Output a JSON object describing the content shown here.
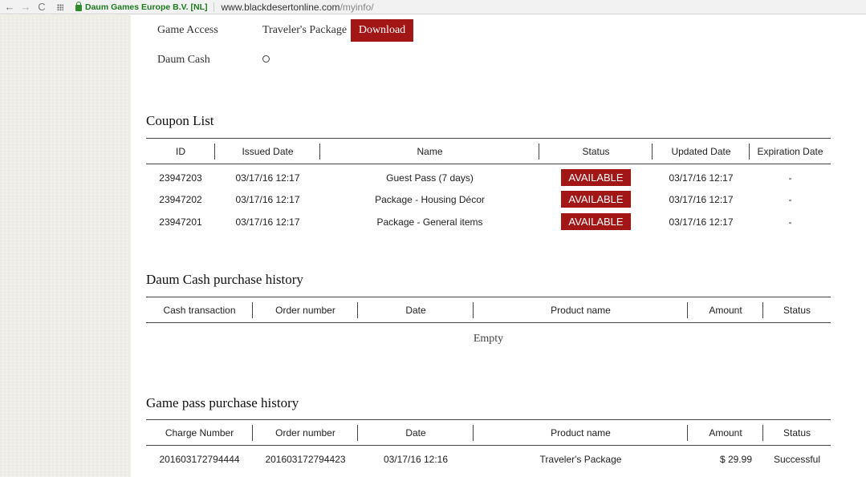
{
  "browser": {
    "back_glyph": "←",
    "forward_glyph": "→",
    "reload_glyph": "C",
    "cert_name": "Daum Games Europe B.V. [NL]",
    "url_host": "www.blackdesertonline.com",
    "url_path": "/myinfo/"
  },
  "account": {
    "game_access_label": "Game Access",
    "game_access_value": "Traveler's Package",
    "download_label": "Download",
    "daum_cash_label": "Daum Cash"
  },
  "coupons": {
    "title": "Coupon List",
    "headers": [
      "ID",
      "Issued Date",
      "Name",
      "Status",
      "Updated Date",
      "Expiration Date"
    ],
    "rows": [
      {
        "id": "23947203",
        "issued": "03/17/16 12:17",
        "name": "Guest Pass (7 days)",
        "status": "AVAILABLE",
        "updated": "03/17/16 12:17",
        "expiration": "-"
      },
      {
        "id": "23947202",
        "issued": "03/17/16 12:17",
        "name": "Package - Housing Décor",
        "status": "AVAILABLE",
        "updated": "03/17/16 12:17",
        "expiration": "-"
      },
      {
        "id": "23947201",
        "issued": "03/17/16 12:17",
        "name": "Package - General items",
        "status": "AVAILABLE",
        "updated": "03/17/16 12:17",
        "expiration": "-"
      }
    ]
  },
  "cash_history": {
    "title": "Daum Cash purchase history",
    "headers": [
      "Cash transaction",
      "Order number",
      "Date",
      "Product name",
      "Amount",
      "Status"
    ],
    "empty_text": "Empty"
  },
  "gamepass_history": {
    "title": "Game pass purchase history",
    "headers": [
      "Charge Number",
      "Order number",
      "Date",
      "Product name",
      "Amount",
      "Status"
    ],
    "rows": [
      {
        "charge": "201603172794444",
        "order": "201603172794423",
        "date": "03/17/16 12:16",
        "product": "Traveler's Package",
        "amount": "$ 29.99",
        "status": "Successful"
      }
    ]
  },
  "colors": {
    "accent": "#a31616",
    "side_panel": "#efeee7"
  }
}
